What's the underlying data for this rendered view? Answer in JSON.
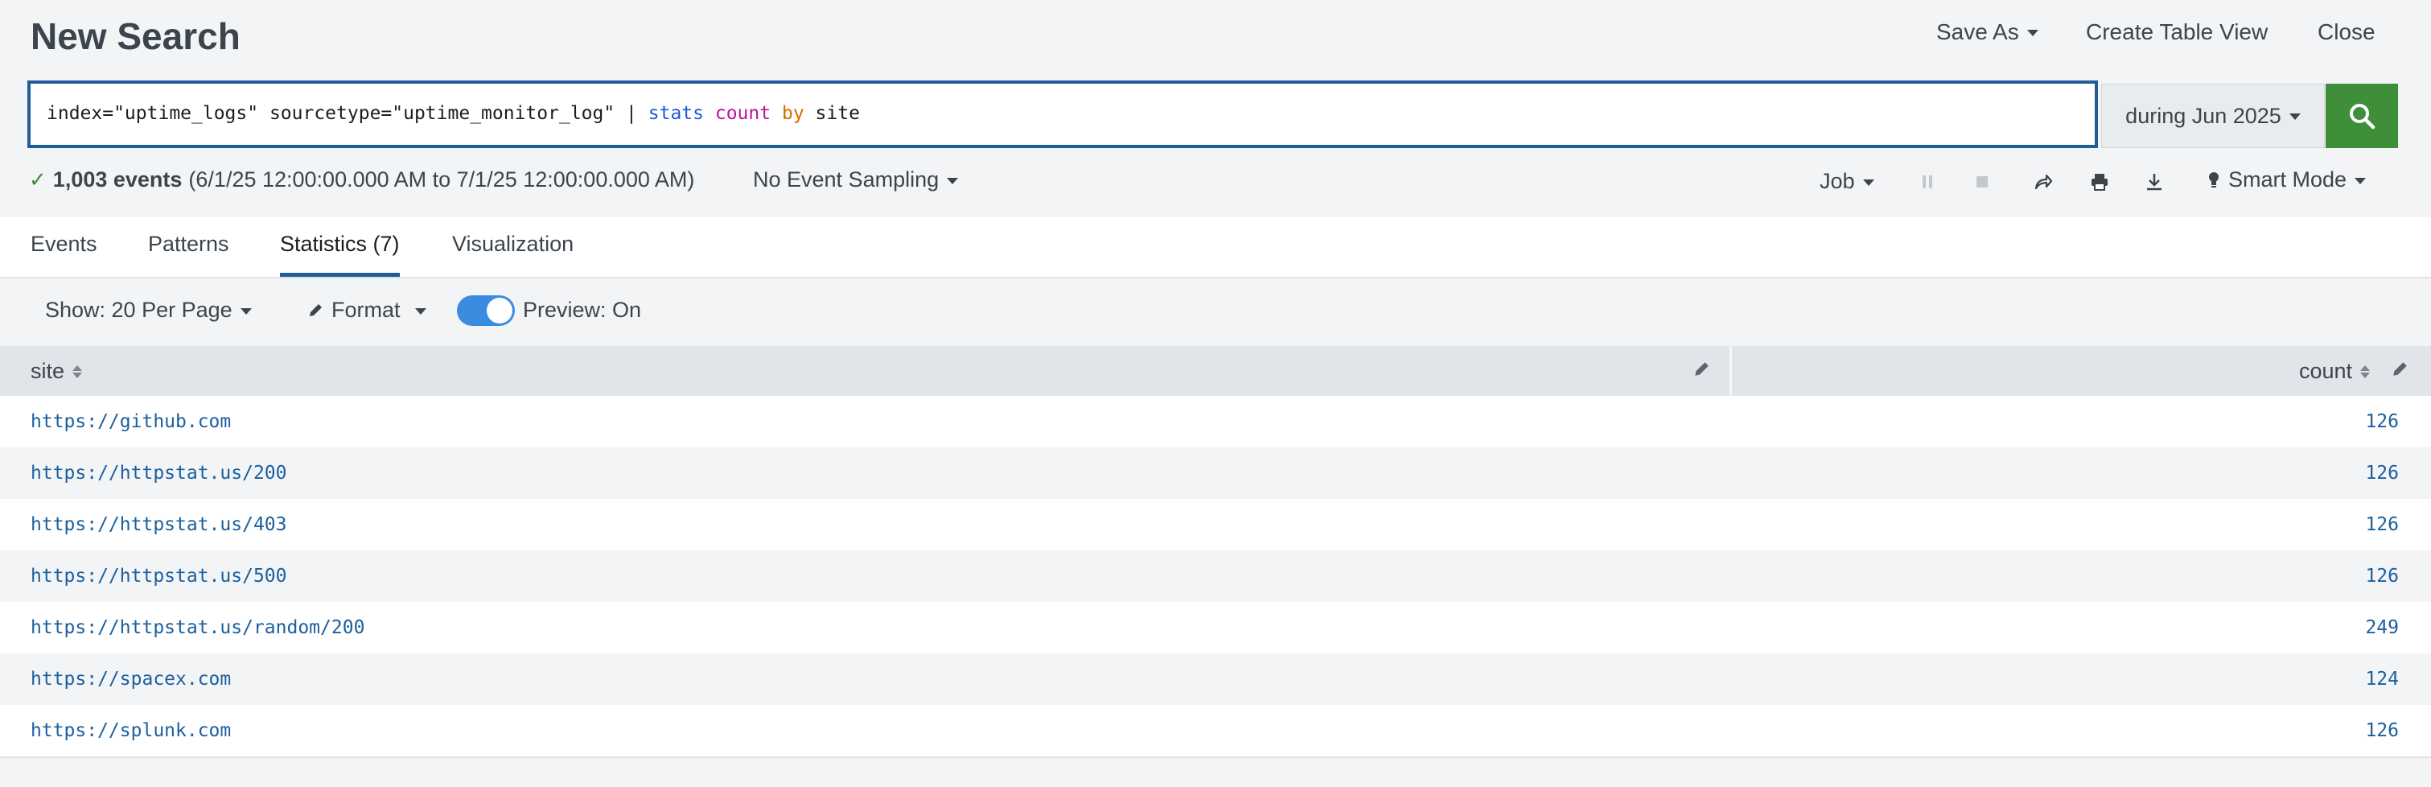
{
  "header": {
    "title": "New Search",
    "save_as": "Save As",
    "create_table_view": "Create Table View",
    "close": "Close"
  },
  "search": {
    "query_base": "index=\"uptime_logs\" sourcetype=\"uptime_monitor_log\" | ",
    "query_cmd": "stats",
    "query_fn": "count",
    "query_by": "by",
    "query_field": "site",
    "time_range": "during Jun 2025",
    "search_icon": "magnifier-icon"
  },
  "status": {
    "events_count": "1,003 events",
    "time_span": "(6/1/25 12:00:00.000 AM to 7/1/25 12:00:00.000 AM)",
    "sampling": "No Event Sampling",
    "job": "Job",
    "mode": "Smart Mode"
  },
  "tabs": [
    {
      "label": "Events"
    },
    {
      "label": "Patterns"
    },
    {
      "label": "Statistics (7)"
    },
    {
      "label": "Visualization"
    }
  ],
  "toolbar": {
    "show": "Show: 20 Per Page",
    "format": "Format",
    "preview": "Preview: On"
  },
  "table": {
    "columns": [
      "site",
      "count"
    ],
    "rows": [
      {
        "site": "https://github.com",
        "count": "126"
      },
      {
        "site": "https://httpstat.us/200",
        "count": "126"
      },
      {
        "site": "https://httpstat.us/403",
        "count": "126"
      },
      {
        "site": "https://httpstat.us/500",
        "count": "126"
      },
      {
        "site": "https://httpstat.us/random/200",
        "count": "249"
      },
      {
        "site": "https://spacex.com",
        "count": "124"
      },
      {
        "site": "https://splunk.com",
        "count": "126"
      }
    ]
  },
  "colors": {
    "accent": "#1f5c99",
    "search_button": "#3f8e3a",
    "link": "#1b5f9e",
    "toggle": "#3b8ce0"
  }
}
